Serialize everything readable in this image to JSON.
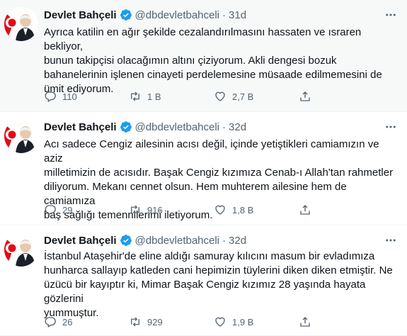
{
  "tweets": [
    {
      "name": "Devlet Bahçeli",
      "handle": "@dbdevletbahceli",
      "separator": "·",
      "time": "31d",
      "text": "Ayrıca katilin en ağır şekilde cezalandırılmasını hassaten ve ısraren bekliyor,\nbunun takipçisi olacağımın altını çiziyorum. Akli dengesi bozuk\nbahanelerinin işlenen cinayeti perdelemesine müsaade edilmemesini de\nümit ediyorum.",
      "replies": "110",
      "retweets": "1 B",
      "likes": "2,7 B"
    },
    {
      "name": "Devlet Bahçeli",
      "handle": "@dbdevletbahceli",
      "separator": "·",
      "time": "32d",
      "text": "Acı sadece Cengiz ailesinin acısı değil, içinde yetiştikleri camiamızın ve aziz\nmilletimizin de acısıdır. Başak Cengiz kızımıza Cenab-ı Allah'tan rahmetler\ndiliyorum. Mekanı cennet olsun. Hem muhterem ailesine hem de camiamıza\nbaş sağlığı temennilerimi iletiyorum.",
      "replies": "29",
      "retweets": "916",
      "likes": "1,8 B"
    },
    {
      "name": "Devlet Bahçeli",
      "handle": "@dbdevletbahceli",
      "separator": "·",
      "time": "32d",
      "text": "İstanbul Ataşehir'de eline aldığı samuray kılıcını masum bir evladımıza\nhunharca sallayıp katleden cani hepimizin tüylerini diken diken etmiştir. Ne\nüzücü bir kayıptır ki, Mimar Başak Cengiz kızımız 28 yaşında hayata gözlerini\nyummuştur.",
      "replies": "26",
      "retweets": "929",
      "likes": "1,9 B"
    }
  ],
  "icons": {
    "avatar": "flag-portrait-avatar",
    "verified": "verified-badge-icon",
    "more": "more-dots-icon",
    "reply": "reply-icon",
    "retweet": "retweet-icon",
    "like": "heart-icon",
    "share": "share-icon"
  },
  "colors": {
    "accent": "#1d9bf0",
    "text": "#0f1419",
    "secondary": "#536471",
    "divider": "#eff3f4",
    "hover_bg": "#f7f9f9",
    "flag_red": "#e30a17"
  }
}
